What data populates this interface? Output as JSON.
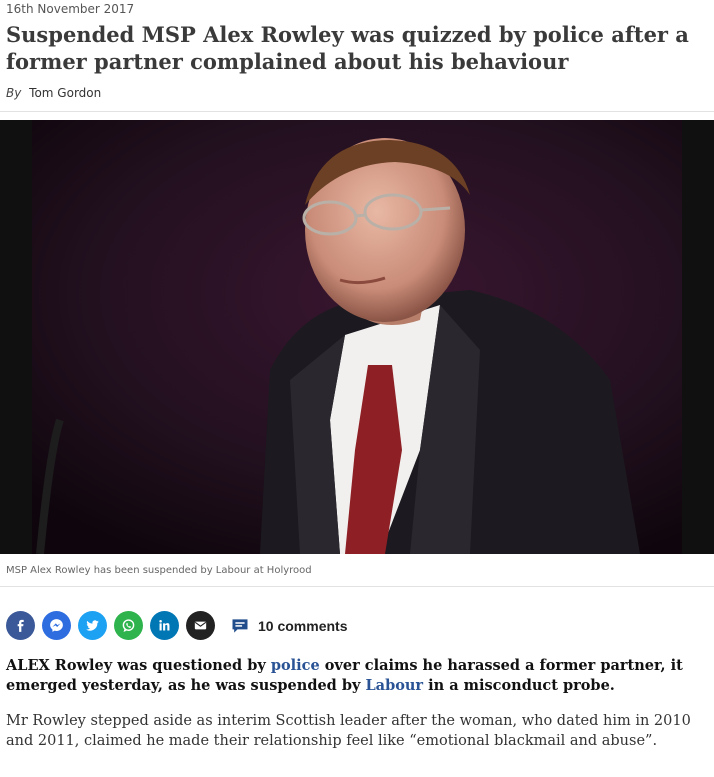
{
  "article": {
    "date": "16th November 2017",
    "headline": "Suspended MSP Alex Rowley was quizzed by police after a former partner complained about his behaviour",
    "byline": {
      "prefix": "By",
      "author": "Tom Gordon"
    },
    "photo": {
      "caption": "MSP Alex Rowley has been suspended by Labour at Holyrood"
    },
    "share": {
      "buttons": [
        {
          "name": "facebook",
          "icon": "facebook-icon",
          "color": "#3b5998"
        },
        {
          "name": "messenger",
          "icon": "messenger-icon",
          "color": "#2d6de0"
        },
        {
          "name": "twitter",
          "icon": "twitter-icon",
          "color": "#1da1f2"
        },
        {
          "name": "whatsapp",
          "icon": "whatsapp-icon",
          "color": "#2eb34d"
        },
        {
          "name": "linkedin",
          "icon": "linkedin-icon",
          "color": "#0077b5"
        },
        {
          "name": "email",
          "icon": "envelope-icon",
          "color": "#222222"
        }
      ],
      "comments_label": "10 comments",
      "comments_icon": "speech-bubble-icon",
      "comments_color": "#224d8c"
    },
    "lede": {
      "part1": "ALEX Rowley was questioned by ",
      "link1": "police",
      "part2": " over claims he harassed a former partner, it emerged yesterday, as he was suspended by ",
      "link2": "Labour",
      "part3": " in a misconduct probe."
    },
    "paragraph": "Mr Rowley stepped aside as interim Scottish leader after the woman, who dated him in 2010 and 2011, claimed he made their relationship feel like “emotional blackmail and abuse”."
  }
}
